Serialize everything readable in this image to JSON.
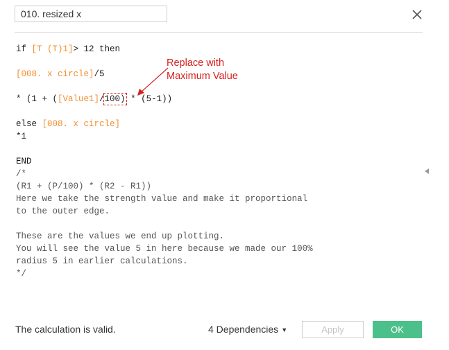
{
  "dialog": {
    "calc_name": "010. resized x",
    "close_icon": "close-icon"
  },
  "editor": {
    "lines": [
      {
        "parts": [
          {
            "t": "if ",
            "c": "kw"
          },
          {
            "t": "[T (T)1]",
            "c": "field"
          },
          {
            "t": "> 12 then",
            "c": "kw"
          }
        ]
      },
      {
        "parts": [
          {
            "t": "",
            "c": "kw"
          }
        ]
      },
      {
        "parts": [
          {
            "t": "[008. x circle]",
            "c": "field"
          },
          {
            "t": "/5",
            "c": "kw"
          }
        ]
      },
      {
        "parts": [
          {
            "t": "",
            "c": "kw"
          }
        ]
      },
      {
        "parts": [
          {
            "t": "* (1 + (",
            "c": "kw"
          },
          {
            "t": "[Value1]",
            "c": "field"
          },
          {
            "t": "/",
            "c": "kw"
          },
          {
            "t": "100)",
            "c": "kw boxed"
          },
          {
            "t": " * (5-1))",
            "c": "kw"
          }
        ]
      },
      {
        "parts": [
          {
            "t": "",
            "c": "kw"
          }
        ]
      },
      {
        "parts": [
          {
            "t": "else ",
            "c": "kw"
          },
          {
            "t": "[008. x circle]",
            "c": "field"
          }
        ]
      },
      {
        "parts": [
          {
            "t": "*1",
            "c": "kw"
          }
        ]
      },
      {
        "parts": [
          {
            "t": "",
            "c": "kw"
          }
        ]
      },
      {
        "parts": [
          {
            "t": "END",
            "c": "kw"
          }
        ]
      },
      {
        "parts": [
          {
            "t": "/*",
            "c": "cmt"
          }
        ]
      },
      {
        "parts": [
          {
            "t": "(R1 + (P/100) * (R2 - R1))",
            "c": "cmt"
          }
        ]
      },
      {
        "parts": [
          {
            "t": "Here we take the strength value and make it proportional",
            "c": "cmt"
          }
        ]
      },
      {
        "parts": [
          {
            "t": "to the outer edge.",
            "c": "cmt"
          }
        ]
      },
      {
        "parts": [
          {
            "t": "",
            "c": "cmt"
          }
        ]
      },
      {
        "parts": [
          {
            "t": "These are the values we end up plotting.",
            "c": "cmt"
          }
        ]
      },
      {
        "parts": [
          {
            "t": "You will see the value 5 in here because we made our 100%",
            "c": "cmt"
          }
        ]
      },
      {
        "parts": [
          {
            "t": "radius 5 in earlier calculations.",
            "c": "cmt"
          }
        ]
      },
      {
        "parts": [
          {
            "t": "*/",
            "c": "cmt"
          }
        ]
      }
    ]
  },
  "annotation": {
    "line1": "Replace with",
    "line2": "Maximum Value",
    "color": "#d62020"
  },
  "footer": {
    "status": "The calculation is valid.",
    "dependencies": "4 Dependencies",
    "dependencies_caret": "▼",
    "apply": "Apply",
    "ok": "OK",
    "ok_color": "#4cc08a"
  }
}
